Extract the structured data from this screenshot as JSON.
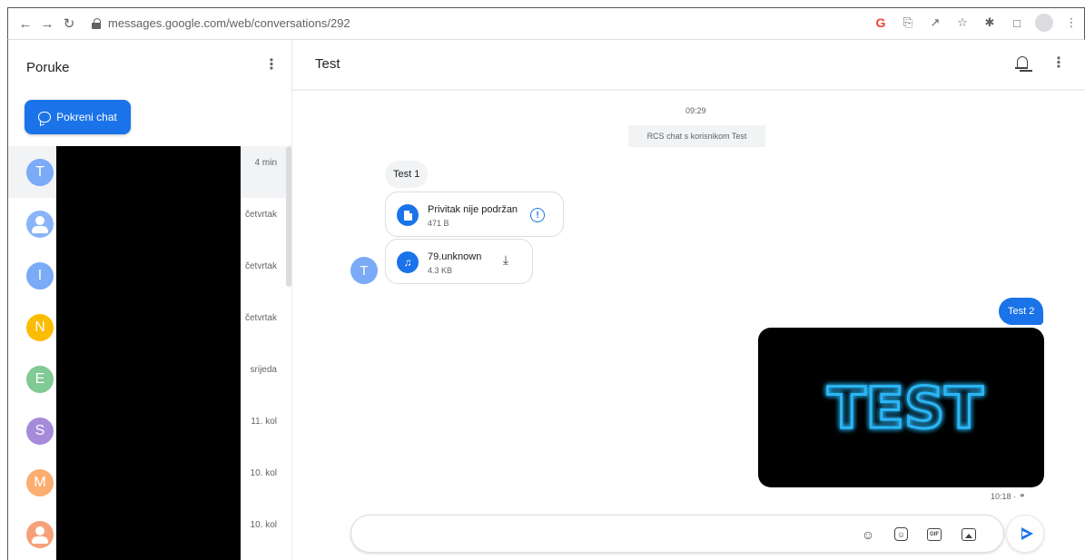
{
  "browser": {
    "url": "messages.google.com/web/conversations/292",
    "back_icon": "arrow-left-icon",
    "forward_icon": "arrow-right-icon",
    "reload_icon": "reload-icon",
    "google_label": "G"
  },
  "sidebar": {
    "title": "Poruke",
    "start_chat_label": "Pokreni chat",
    "conversations": [
      {
        "initial": "T",
        "color": "#7baaf7",
        "time": "4 min",
        "active": true,
        "person": false
      },
      {
        "initial": "",
        "color": "#8ab4f8",
        "time": "četvrtak",
        "active": false,
        "person": true
      },
      {
        "initial": "I",
        "color": "#7baaf7",
        "time": "četvrtak",
        "active": false,
        "person": false
      },
      {
        "initial": "N",
        "color": "#fbbc04",
        "time": "četvrtak",
        "active": false,
        "person": false
      },
      {
        "initial": "E",
        "color": "#81c995",
        "time": "srijeda",
        "active": false,
        "person": false
      },
      {
        "initial": "S",
        "color": "#a78bdb",
        "time": "11. kol",
        "active": false,
        "person": false
      },
      {
        "initial": "M",
        "color": "#fcad70",
        "time": "10. kol",
        "active": false,
        "person": false
      },
      {
        "initial": "",
        "color": "#f6a07a",
        "time": "10. kol",
        "active": false,
        "person": true
      }
    ]
  },
  "conversation": {
    "title": "Test",
    "timestamp": "09:29",
    "rcs_note": "RCS chat s korisnikom Test",
    "incoming_text": "Test 1",
    "sender_initial": "T",
    "attachments": [
      {
        "name": "Privitak nije podržan",
        "size": "471 B"
      },
      {
        "name": "79.unknown",
        "size": "4.3 KB"
      }
    ],
    "outgoing_text": "Test 2",
    "outgoing_image_text": "TEST",
    "outgoing_time": "10:18 ·",
    "composer_placeholder": ""
  },
  "colors": {
    "accent": "#1a73e8",
    "neon": "#29b6f6"
  }
}
